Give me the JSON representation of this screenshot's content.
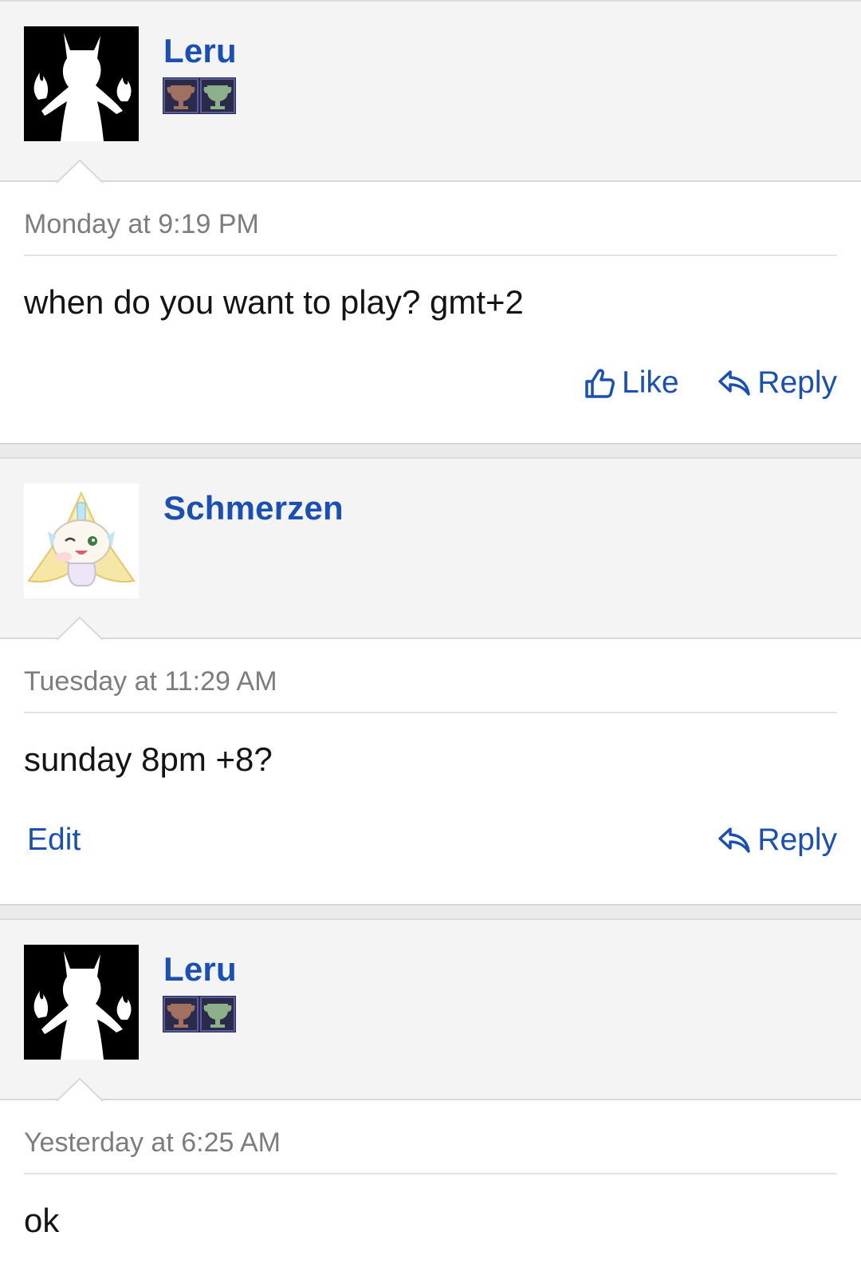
{
  "posts": [
    {
      "username": "Leru",
      "avatar": "fox-silhouette-avatar",
      "trophies": [
        "bronze-trophy-icon",
        "green-trophy-icon"
      ],
      "timestamp": "Monday at 9:19 PM",
      "message": "when do you want to play? gmt+2",
      "actions": {
        "like": "Like",
        "reply": "Reply"
      }
    },
    {
      "username": "Schmerzen",
      "avatar": "jirachi-avatar",
      "trophies": [],
      "timestamp": "Tuesday at 11:29 AM",
      "message": "sunday 8pm +8?",
      "actions": {
        "edit": "Edit",
        "reply": "Reply"
      }
    },
    {
      "username": "Leru",
      "avatar": "fox-silhouette-avatar",
      "trophies": [
        "bronze-trophy-icon",
        "green-trophy-icon"
      ],
      "timestamp": "Yesterday at 6:25 AM",
      "message": "ok",
      "actions": {}
    }
  ],
  "colors": {
    "link": "#1a4fb3",
    "header_bg": "#f4f4f4",
    "meta_text": "#7d7d7d"
  }
}
